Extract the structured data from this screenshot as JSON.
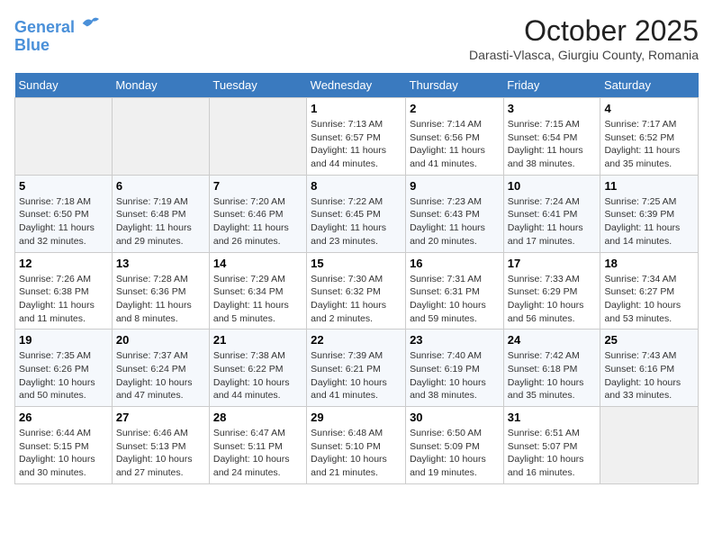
{
  "header": {
    "logo_line1": "General",
    "logo_line2": "Blue",
    "month_title": "October 2025",
    "subtitle": "Darasti-Vlasca, Giurgiu County, Romania"
  },
  "weekdays": [
    "Sunday",
    "Monday",
    "Tuesday",
    "Wednesday",
    "Thursday",
    "Friday",
    "Saturday"
  ],
  "weeks": [
    [
      {
        "day": "",
        "info": ""
      },
      {
        "day": "",
        "info": ""
      },
      {
        "day": "",
        "info": ""
      },
      {
        "day": "1",
        "info": "Sunrise: 7:13 AM\nSunset: 6:57 PM\nDaylight: 11 hours and 44 minutes."
      },
      {
        "day": "2",
        "info": "Sunrise: 7:14 AM\nSunset: 6:56 PM\nDaylight: 11 hours and 41 minutes."
      },
      {
        "day": "3",
        "info": "Sunrise: 7:15 AM\nSunset: 6:54 PM\nDaylight: 11 hours and 38 minutes."
      },
      {
        "day": "4",
        "info": "Sunrise: 7:17 AM\nSunset: 6:52 PM\nDaylight: 11 hours and 35 minutes."
      }
    ],
    [
      {
        "day": "5",
        "info": "Sunrise: 7:18 AM\nSunset: 6:50 PM\nDaylight: 11 hours and 32 minutes."
      },
      {
        "day": "6",
        "info": "Sunrise: 7:19 AM\nSunset: 6:48 PM\nDaylight: 11 hours and 29 minutes."
      },
      {
        "day": "7",
        "info": "Sunrise: 7:20 AM\nSunset: 6:46 PM\nDaylight: 11 hours and 26 minutes."
      },
      {
        "day": "8",
        "info": "Sunrise: 7:22 AM\nSunset: 6:45 PM\nDaylight: 11 hours and 23 minutes."
      },
      {
        "day": "9",
        "info": "Sunrise: 7:23 AM\nSunset: 6:43 PM\nDaylight: 11 hours and 20 minutes."
      },
      {
        "day": "10",
        "info": "Sunrise: 7:24 AM\nSunset: 6:41 PM\nDaylight: 11 hours and 17 minutes."
      },
      {
        "day": "11",
        "info": "Sunrise: 7:25 AM\nSunset: 6:39 PM\nDaylight: 11 hours and 14 minutes."
      }
    ],
    [
      {
        "day": "12",
        "info": "Sunrise: 7:26 AM\nSunset: 6:38 PM\nDaylight: 11 hours and 11 minutes."
      },
      {
        "day": "13",
        "info": "Sunrise: 7:28 AM\nSunset: 6:36 PM\nDaylight: 11 hours and 8 minutes."
      },
      {
        "day": "14",
        "info": "Sunrise: 7:29 AM\nSunset: 6:34 PM\nDaylight: 11 hours and 5 minutes."
      },
      {
        "day": "15",
        "info": "Sunrise: 7:30 AM\nSunset: 6:32 PM\nDaylight: 11 hours and 2 minutes."
      },
      {
        "day": "16",
        "info": "Sunrise: 7:31 AM\nSunset: 6:31 PM\nDaylight: 10 hours and 59 minutes."
      },
      {
        "day": "17",
        "info": "Sunrise: 7:33 AM\nSunset: 6:29 PM\nDaylight: 10 hours and 56 minutes."
      },
      {
        "day": "18",
        "info": "Sunrise: 7:34 AM\nSunset: 6:27 PM\nDaylight: 10 hours and 53 minutes."
      }
    ],
    [
      {
        "day": "19",
        "info": "Sunrise: 7:35 AM\nSunset: 6:26 PM\nDaylight: 10 hours and 50 minutes."
      },
      {
        "day": "20",
        "info": "Sunrise: 7:37 AM\nSunset: 6:24 PM\nDaylight: 10 hours and 47 minutes."
      },
      {
        "day": "21",
        "info": "Sunrise: 7:38 AM\nSunset: 6:22 PM\nDaylight: 10 hours and 44 minutes."
      },
      {
        "day": "22",
        "info": "Sunrise: 7:39 AM\nSunset: 6:21 PM\nDaylight: 10 hours and 41 minutes."
      },
      {
        "day": "23",
        "info": "Sunrise: 7:40 AM\nSunset: 6:19 PM\nDaylight: 10 hours and 38 minutes."
      },
      {
        "day": "24",
        "info": "Sunrise: 7:42 AM\nSunset: 6:18 PM\nDaylight: 10 hours and 35 minutes."
      },
      {
        "day": "25",
        "info": "Sunrise: 7:43 AM\nSunset: 6:16 PM\nDaylight: 10 hours and 33 minutes."
      }
    ],
    [
      {
        "day": "26",
        "info": "Sunrise: 6:44 AM\nSunset: 5:15 PM\nDaylight: 10 hours and 30 minutes."
      },
      {
        "day": "27",
        "info": "Sunrise: 6:46 AM\nSunset: 5:13 PM\nDaylight: 10 hours and 27 minutes."
      },
      {
        "day": "28",
        "info": "Sunrise: 6:47 AM\nSunset: 5:11 PM\nDaylight: 10 hours and 24 minutes."
      },
      {
        "day": "29",
        "info": "Sunrise: 6:48 AM\nSunset: 5:10 PM\nDaylight: 10 hours and 21 minutes."
      },
      {
        "day": "30",
        "info": "Sunrise: 6:50 AM\nSunset: 5:09 PM\nDaylight: 10 hours and 19 minutes."
      },
      {
        "day": "31",
        "info": "Sunrise: 6:51 AM\nSunset: 5:07 PM\nDaylight: 10 hours and 16 minutes."
      },
      {
        "day": "",
        "info": ""
      }
    ]
  ]
}
